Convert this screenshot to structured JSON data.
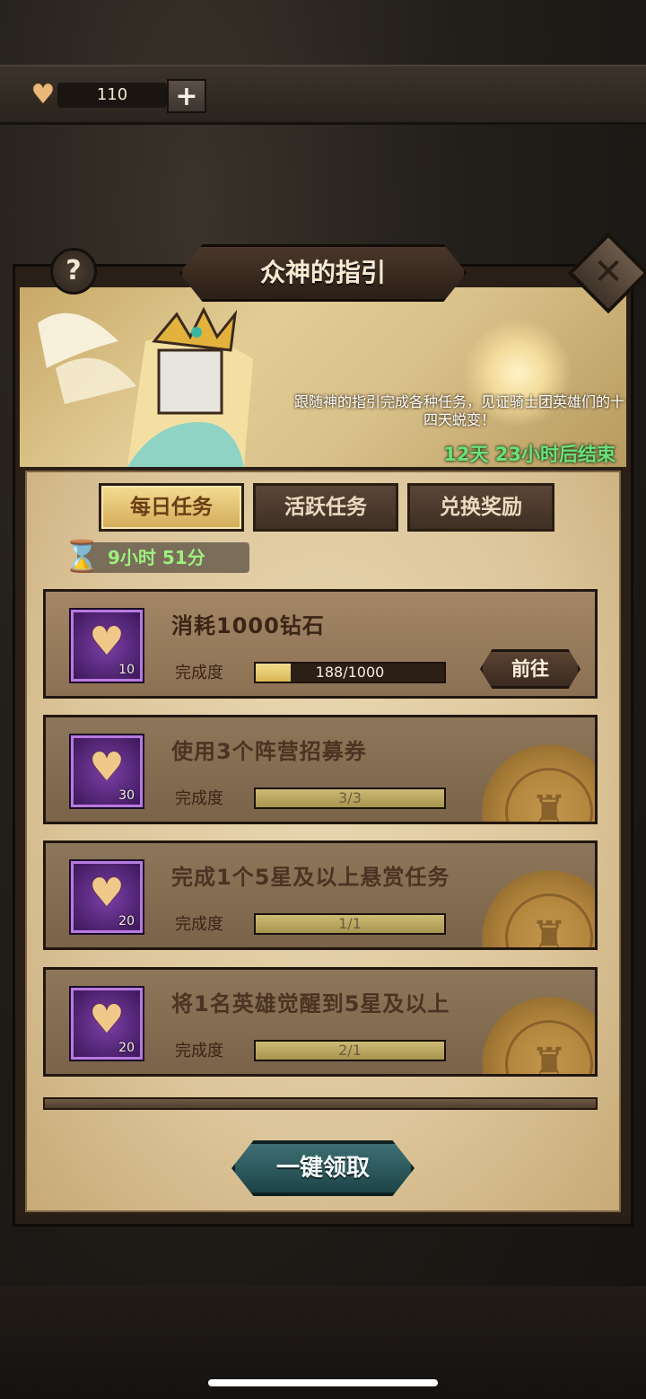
{
  "currency": {
    "icon": "heart-icon",
    "amount": "110",
    "add_label": "+"
  },
  "panel": {
    "title": "众神的指引",
    "help_label": "?",
    "close_label": "✕",
    "description": "跟随神的指引完成各种任务，见证骑士团英雄们的十四天蜕变！",
    "ends_in": "12天 23小时后结束"
  },
  "tabs": [
    {
      "label": "每日任务",
      "active": true
    },
    {
      "label": "活跃任务",
      "active": false
    },
    {
      "label": "兑换奖励",
      "active": false
    }
  ],
  "timer": {
    "label": "9小时 51分"
  },
  "tasks": [
    {
      "title": "消耗1000钻石",
      "reward_count": "10",
      "progress_label": "完成度",
      "progress_text": "188/1000",
      "progress": 0.188,
      "completed": false,
      "go_label": "前往"
    },
    {
      "title": "使用3个阵营招募券",
      "reward_count": "30",
      "progress_label": "完成度",
      "progress_text": "3/3",
      "progress": 1.0,
      "completed": true
    },
    {
      "title": "完成1个5星及以上悬赏任务",
      "reward_count": "20",
      "progress_label": "完成度",
      "progress_text": "1/1",
      "progress": 1.0,
      "completed": true
    },
    {
      "title": "将1名英雄觉醒到5星及以上",
      "reward_count": "20",
      "progress_label": "完成度",
      "progress_text": "2/1",
      "progress": 1.0,
      "completed": true
    }
  ],
  "claim_all_label": "一键领取",
  "colors": {
    "accent_gold": "#d9b856",
    "timer_green": "#9df07e",
    "ends_green": "#6de07a",
    "reward_purple": "#7c3fa8"
  }
}
